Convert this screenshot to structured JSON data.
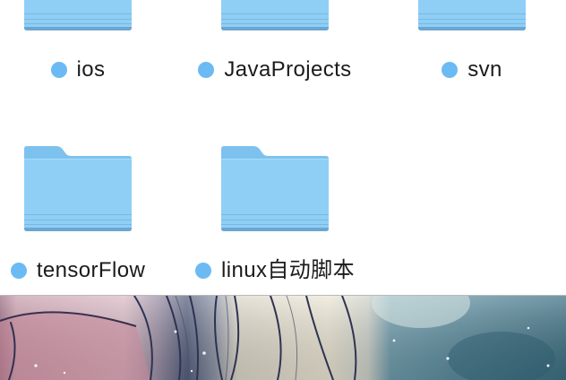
{
  "tag_color": "#6cbaf3",
  "folder_colors": {
    "front": "#8fcff6",
    "back": "#7dc2ef",
    "stripe": "#78b8e2",
    "bottom": "#6ba6d2",
    "highlight": "#a9dcfa"
  },
  "icons": {
    "folder": "folder-icon",
    "tag": "blue-tag-dot",
    "wallpaper": "desktop-wallpaper"
  },
  "folders": [
    {
      "name": "ios"
    },
    {
      "name": "JavaProjects"
    },
    {
      "name": "svn"
    },
    {
      "name": "tensorFlow"
    },
    {
      "name": "linux自动脚本"
    }
  ]
}
